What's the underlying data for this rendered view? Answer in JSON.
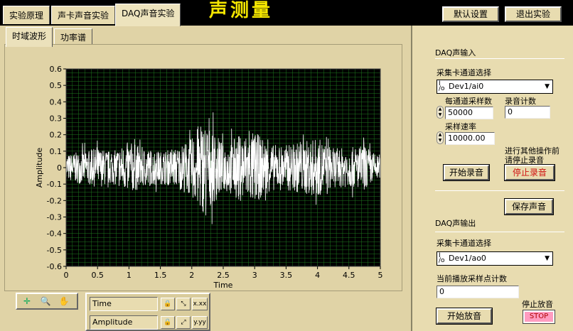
{
  "header": {
    "tabs": [
      {
        "label": "实验原理"
      },
      {
        "label": "声卡声音实验"
      },
      {
        "label": "DAQ声音实验"
      }
    ],
    "title": "声测量",
    "defaults_button": "默认设置",
    "exit_button": "退出实验"
  },
  "left": {
    "subtabs": [
      {
        "label": "时域波形"
      },
      {
        "label": "功率谱"
      }
    ],
    "graph": {
      "ylabel": "Amplitude",
      "xlabel": "Time"
    },
    "scale_legend": {
      "x_name": "Time",
      "y_name": "Amplitude",
      "x_format": "x.xx",
      "y_format": "y.yy"
    }
  },
  "right": {
    "input_section": {
      "title": "DAQ声输入",
      "channel_label": "采集卡通道选择",
      "channel_value": "Dev1/ai0",
      "samples_label": "每通道采样数",
      "samples_value": "50000",
      "record_count_label": "录音计数",
      "record_count_value": "0",
      "rate_label": "采样速率",
      "rate_value": "10000.00",
      "note_line1": "进行其他操作前",
      "note_line2": "请停止录音",
      "start_record_button": "开始录音",
      "stop_record_button": "停止录音",
      "save_button": "保存声音"
    },
    "output_section": {
      "title": "DAQ声输出",
      "channel_label": "采集卡通道选择",
      "channel_value": "Dev1/ao0",
      "count_label": "当前播放采样点计数",
      "count_value": "0",
      "play_button": "开始放音",
      "stop_play_label": "停止放音",
      "stop_button": "STOP"
    }
  },
  "chart_data": {
    "type": "line",
    "xlabel": "Time",
    "ylabel": "Amplitude",
    "xlim": [
      0,
      5
    ],
    "ylim": [
      -0.6,
      0.6
    ],
    "x_ticks": [
      0,
      0.5,
      1,
      1.5,
      2,
      2.5,
      3,
      3.5,
      4,
      4.5,
      5
    ],
    "y_ticks": [
      -0.6,
      -0.5,
      -0.4,
      -0.3,
      -0.2,
      -0.1,
      0,
      0.1,
      0.2,
      0.3,
      0.4,
      0.5,
      0.6
    ],
    "grid": true,
    "plot_background": "#000000",
    "grid_color": "#1f7a1f",
    "trace_color": "#ffffff",
    "series": [
      {
        "x": [
          0,
          0.25,
          0.5,
          0.75,
          1.0,
          1.25,
          1.5,
          1.75,
          2.0,
          2.1,
          2.2,
          2.3,
          2.4,
          2.5,
          2.75,
          3.0,
          3.25,
          3.5,
          3.75,
          4.0,
          4.25,
          4.5,
          4.75,
          5.0
        ],
        "envelope": [
          0.08,
          0.1,
          0.12,
          0.1,
          0.16,
          0.12,
          0.1,
          0.12,
          0.18,
          0.26,
          0.28,
          0.24,
          0.2,
          0.14,
          0.2,
          0.22,
          0.14,
          0.14,
          0.16,
          0.18,
          0.12,
          0.12,
          0.14,
          0.06
        ]
      }
    ]
  }
}
